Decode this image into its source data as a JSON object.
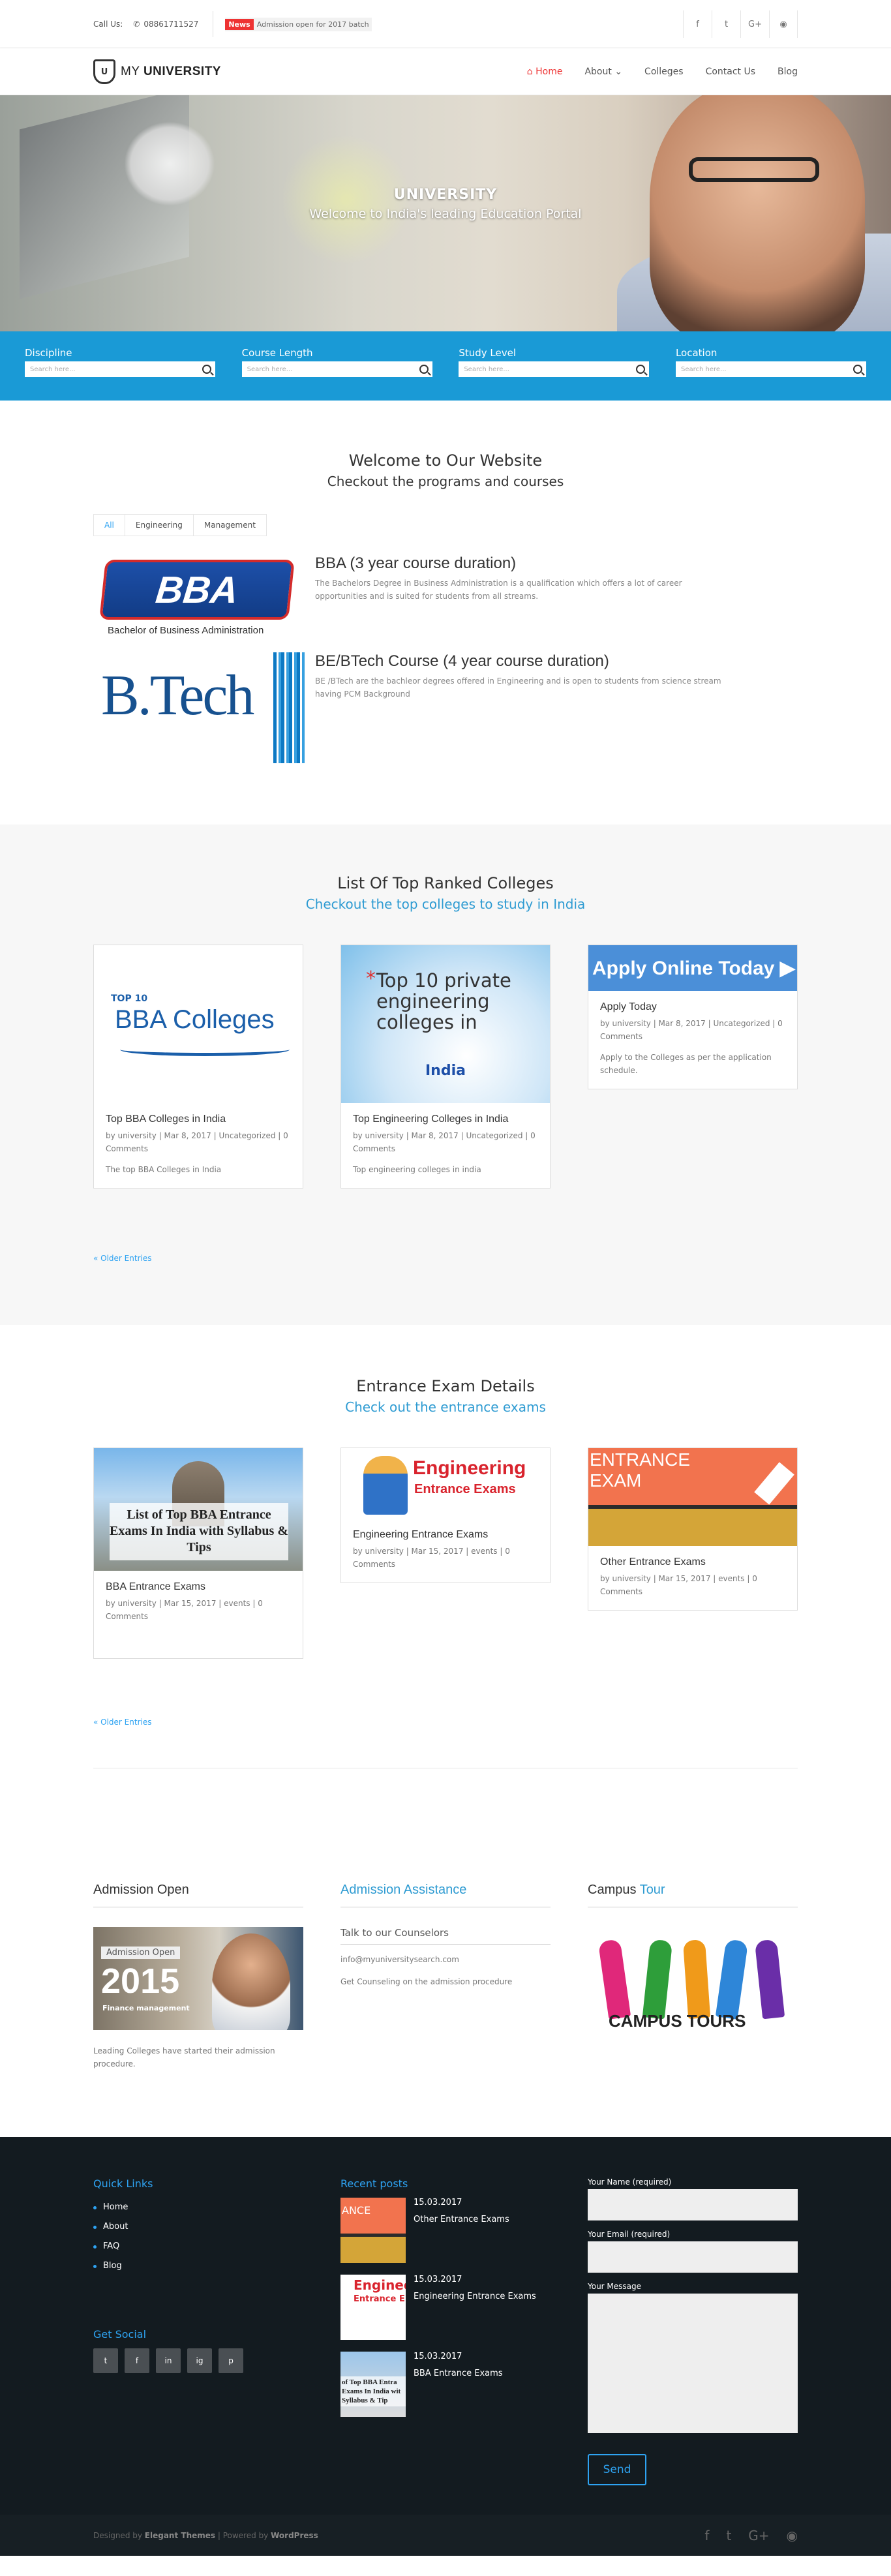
{
  "topbar": {
    "call_label": "Call Us:",
    "phone": "08861711527",
    "news_tag": "News",
    "news_text": "Admission open for 2017 batch",
    "social": [
      "f",
      "t",
      "G+",
      "rss"
    ]
  },
  "header": {
    "logo_prefix": "MY",
    "logo_main": "UNIVERSITY",
    "nav": [
      "Home",
      "About",
      "Colleges",
      "Contact Us",
      "Blog"
    ]
  },
  "hero": {
    "title": "UNIVERSITY",
    "subtitle": "Welcome to India's leading Education Portal"
  },
  "search": [
    {
      "label": "Discipline",
      "placeholder": "Search here..."
    },
    {
      "label": "Course Length",
      "placeholder": "Search here..."
    },
    {
      "label": "Study Level",
      "placeholder": "Search here..."
    },
    {
      "label": "Location",
      "placeholder": "Search here..."
    }
  ],
  "welcome": {
    "title": "Welcome to Our Website",
    "subtitle": "Checkout the  programs and courses",
    "filters": [
      "All",
      "Engineering",
      "Management"
    ],
    "courses": [
      {
        "title": "BBA (3 year course duration)",
        "desc": "The Bachelors Degree in Business Administration is a qualification which offers a lot of career opportunities and is suited for students from all streams.",
        "img_text": "BBA",
        "img_caption": "Bachelor of Business Administration"
      },
      {
        "title": "BE/BTech Course (4 year course duration)",
        "desc": "BE /BTech are the bachleor degrees offered in Engineering and is open to students from science stream having PCM Background",
        "img_text": "B.Tech"
      }
    ]
  },
  "ranked": {
    "title": "List Of Top Ranked Colleges",
    "subtitle": "Checkout the top colleges to study in India",
    "cards": [
      {
        "title": "Top BBA Colleges in India",
        "meta": "by university | Mar 8, 2017 | Uncategorized | 0 Comments",
        "excerpt": "The top BBA Colleges in India",
        "img_top": "TOP 10",
        "img_main": "BBA Colleges"
      },
      {
        "title": "Top Engineering Colleges in India",
        "meta": "by university | Mar 8, 2017 | Uncategorized | 0 Comments",
        "excerpt": "Top engineering colleges in india",
        "img_main": "Top 10 private engineering colleges in",
        "img_country": "India"
      },
      {
        "title": "Apply Today",
        "meta": "by university | Mar 8, 2017 | Uncategorized | 0 Comments",
        "excerpt": "Apply to the Colleges as per the application schedule.",
        "img_main": "Apply Online Today ▶"
      }
    ],
    "older": "« Older Entries"
  },
  "entrance": {
    "title": "Entrance Exam Details",
    "subtitle": "Check out the entrance exams",
    "cards": [
      {
        "title": "BBA Entrance Exams",
        "meta": "by university | Mar 15, 2017 | events | 0 Comments",
        "img_text": "List of Top BBA Entrance Exams In India with Syllabus & Tips"
      },
      {
        "title": "Engineering Entrance Exams",
        "meta": "by university | Mar 15, 2017 | events | 0 Comments",
        "img_line1": "Engineering",
        "img_line2": "Entrance Exams"
      },
      {
        "title": "Other Entrance Exams",
        "meta": "by university | Mar 15, 2017 | events | 0 Comments",
        "img_text": "ENTRANCE EXAM"
      }
    ],
    "older": "« Older Entries"
  },
  "widgets": {
    "admission": {
      "title": "Admission Open",
      "img_label": "Admission Open",
      "img_year": "2015",
      "img_sub": "Finance management",
      "text": "Leading Colleges have started their admission procedure."
    },
    "assistance": {
      "title": "Admission Assistance",
      "link": "Talk to our Counselors",
      "email": "info@myuniversitysearch.com",
      "line": "Get Counseling on the admission procedure"
    },
    "tour": {
      "title_a": "Campus",
      "title_b": "Tour",
      "img_text": "CAMPUS TOURS"
    }
  },
  "footer": {
    "quick_title": "Quick Links",
    "quick_links": [
      "Home",
      "About",
      "FAQ",
      "Blog"
    ],
    "social_title": "Get Social",
    "social": [
      "t",
      "f",
      "in",
      "ig",
      "p"
    ],
    "recent_title": "Recent posts",
    "recent": [
      {
        "date": "15.03.2017",
        "title": "Other Entrance Exams",
        "thumb": "ANCE"
      },
      {
        "date": "15.03.2017",
        "title": "Engineering Entrance Exams",
        "thumb": "Enginee",
        "thumb2": "Entrance E"
      },
      {
        "date": "15.03.2017",
        "title": "BBA Entrance Exams",
        "thumb": "of Top BBA Entra Exams In India wit Syllabus & Tip"
      }
    ],
    "form": {
      "name_label": "Your Name (required)",
      "email_label": "Your Email (required)",
      "message_label": "Your Message",
      "send": "Send"
    },
    "credit_prefix": "Designed by",
    "credit_a": "Elegant Themes",
    "credit_mid": "| Powered by",
    "credit_b": "WordPress",
    "bottom_social": [
      "f",
      "t",
      "G+",
      "rss"
    ]
  }
}
